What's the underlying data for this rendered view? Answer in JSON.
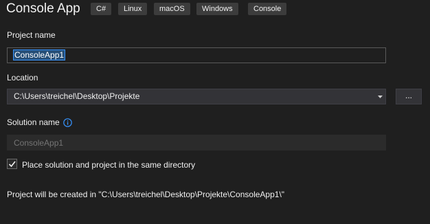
{
  "header": {
    "title": "Console App",
    "tags": [
      "C#",
      "Linux",
      "macOS",
      "Windows",
      "Console"
    ]
  },
  "project_name": {
    "label": "Project name",
    "value": "ConsoleApp1"
  },
  "location": {
    "label": "Location",
    "value": "C:\\Users\\treichel\\Desktop\\Projekte",
    "browse_label": "..."
  },
  "solution_name": {
    "label": "Solution name",
    "placeholder": "ConsoleApp1",
    "info_icon": "info-icon"
  },
  "same_directory": {
    "label": "Place solution and project in the same directory",
    "checked": true
  },
  "footer": {
    "path_text": "Project will be created in \"C:\\Users\\treichel\\Desktop\\Projekte\\ConsoleApp1\\\""
  }
}
